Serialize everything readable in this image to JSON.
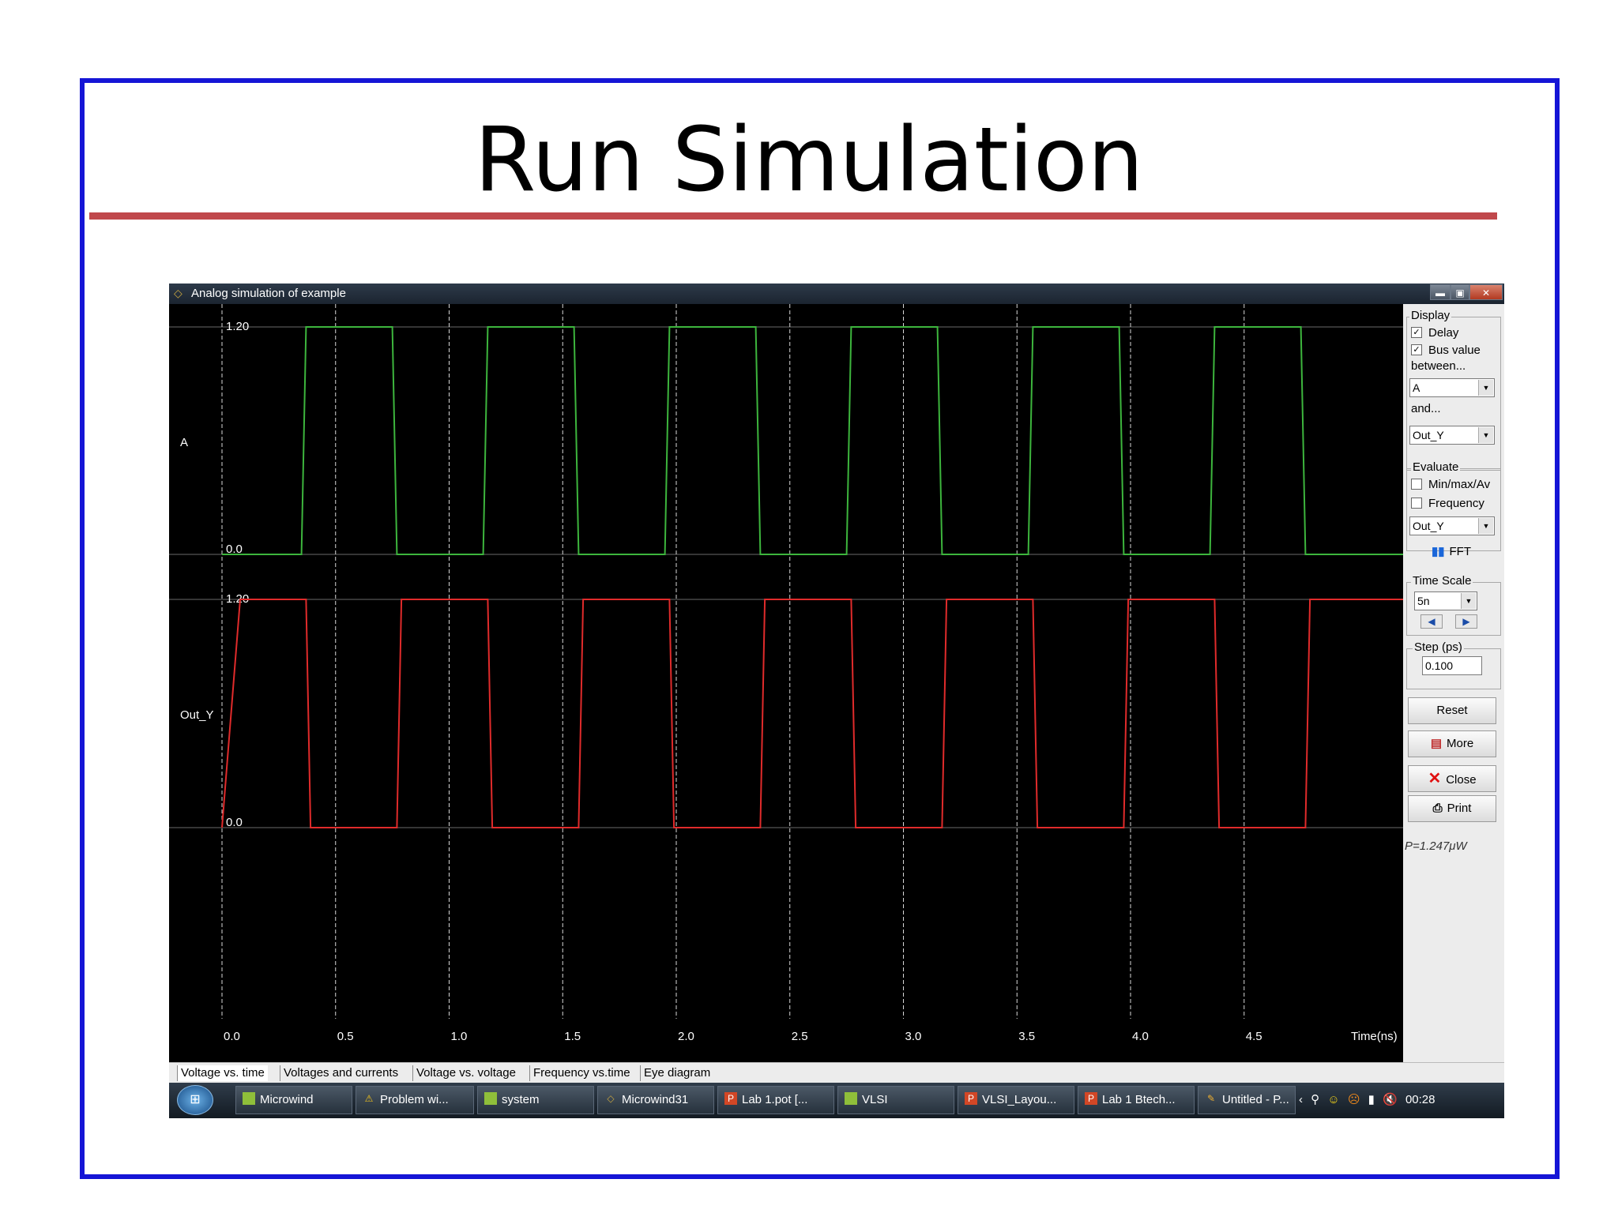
{
  "slide": {
    "title": "Run Simulation"
  },
  "window": {
    "title": "Analog simulation of example",
    "controls": {
      "minimize": "▬",
      "restore": "▣",
      "close": "✕"
    }
  },
  "plot": {
    "signals": [
      {
        "name": "A",
        "color": "#3db53d",
        "y_max_label": "1.20",
        "y_min_label": "0.0"
      },
      {
        "name": "Out_Y",
        "color": "#e02b2b",
        "y_max_label": "1.20",
        "y_min_label": "0.0"
      }
    ],
    "x_ticks": [
      "0.0",
      "0.5",
      "1.0",
      "1.5",
      "2.0",
      "2.5",
      "3.0",
      "3.5",
      "4.0",
      "4.5"
    ],
    "x_unit_label": "Time(ns)"
  },
  "chart_data": {
    "type": "line",
    "x_unit": "ns",
    "xlim": [
      0,
      5.2
    ],
    "ylim": [
      0,
      1.2
    ],
    "grid": true,
    "series": [
      {
        "name": "A",
        "points": [
          [
            0,
            0
          ],
          [
            0.35,
            0
          ],
          [
            0.37,
            1.2
          ],
          [
            0.75,
            1.2
          ],
          [
            0.77,
            0
          ],
          [
            1.15,
            0
          ],
          [
            1.17,
            1.2
          ],
          [
            1.55,
            1.2
          ],
          [
            1.57,
            0
          ],
          [
            1.95,
            0
          ],
          [
            1.97,
            1.2
          ],
          [
            2.35,
            1.2
          ],
          [
            2.37,
            0
          ],
          [
            2.75,
            0
          ],
          [
            2.77,
            1.2
          ],
          [
            3.15,
            1.2
          ],
          [
            3.17,
            0
          ],
          [
            3.55,
            0
          ],
          [
            3.57,
            1.2
          ],
          [
            3.95,
            1.2
          ],
          [
            3.97,
            0
          ],
          [
            4.35,
            0
          ],
          [
            4.37,
            1.2
          ],
          [
            4.75,
            1.2
          ],
          [
            4.77,
            0
          ],
          [
            5.2,
            0
          ]
        ]
      },
      {
        "name": "Out_Y",
        "points": [
          [
            0,
            0
          ],
          [
            0.08,
            1.2
          ],
          [
            0.37,
            1.2
          ],
          [
            0.39,
            0
          ],
          [
            0.77,
            0
          ],
          [
            0.79,
            1.2
          ],
          [
            1.17,
            1.2
          ],
          [
            1.19,
            0
          ],
          [
            1.57,
            0
          ],
          [
            1.59,
            1.2
          ],
          [
            1.97,
            1.2
          ],
          [
            1.99,
            0
          ],
          [
            2.37,
            0
          ],
          [
            2.39,
            1.2
          ],
          [
            2.77,
            1.2
          ],
          [
            2.79,
            0
          ],
          [
            3.17,
            0
          ],
          [
            3.19,
            1.2
          ],
          [
            3.57,
            1.2
          ],
          [
            3.59,
            0
          ],
          [
            3.97,
            0
          ],
          [
            3.99,
            1.2
          ],
          [
            4.37,
            1.2
          ],
          [
            4.39,
            0
          ],
          [
            4.77,
            0
          ],
          [
            4.79,
            1.2
          ],
          [
            5.2,
            1.2
          ]
        ]
      }
    ]
  },
  "panel": {
    "display_title": "Display",
    "delay_label": "Delay",
    "delay_checked": true,
    "bus_value_label": "Bus value",
    "bus_value_checked": true,
    "between_label": "between...",
    "between_value": "A",
    "and_label": "and...",
    "and_value": "Out_Y",
    "evaluate_title": "Evaluate",
    "minmax_label": "Min/max/Av",
    "minmax_checked": false,
    "frequency_label": "Frequency",
    "frequency_checked": false,
    "evaluate_value": "Out_Y",
    "fft_label": "FFT",
    "timescale_title": "Time Scale",
    "timescale_value": "5n",
    "step_title": "Step (ps)",
    "step_value": "0.100",
    "reset_label": "Reset",
    "more_label": "More",
    "close_label": "Close",
    "print_label": "Print",
    "power_text": "P=1.247μW"
  },
  "tabs": [
    "Voltage vs. time",
    "Voltages and currents",
    "Voltage vs. voltage",
    "Frequency vs.time",
    "Eye diagram"
  ],
  "taskbar": {
    "items": [
      "Microwind",
      "Problem wi...",
      "system",
      "Microwind31",
      "Lab 1.pot [...",
      "VLSI",
      "VLSI_Layou...",
      "Lab 1 Btech...",
      "Untitled - P..."
    ],
    "clock": "00:28"
  }
}
